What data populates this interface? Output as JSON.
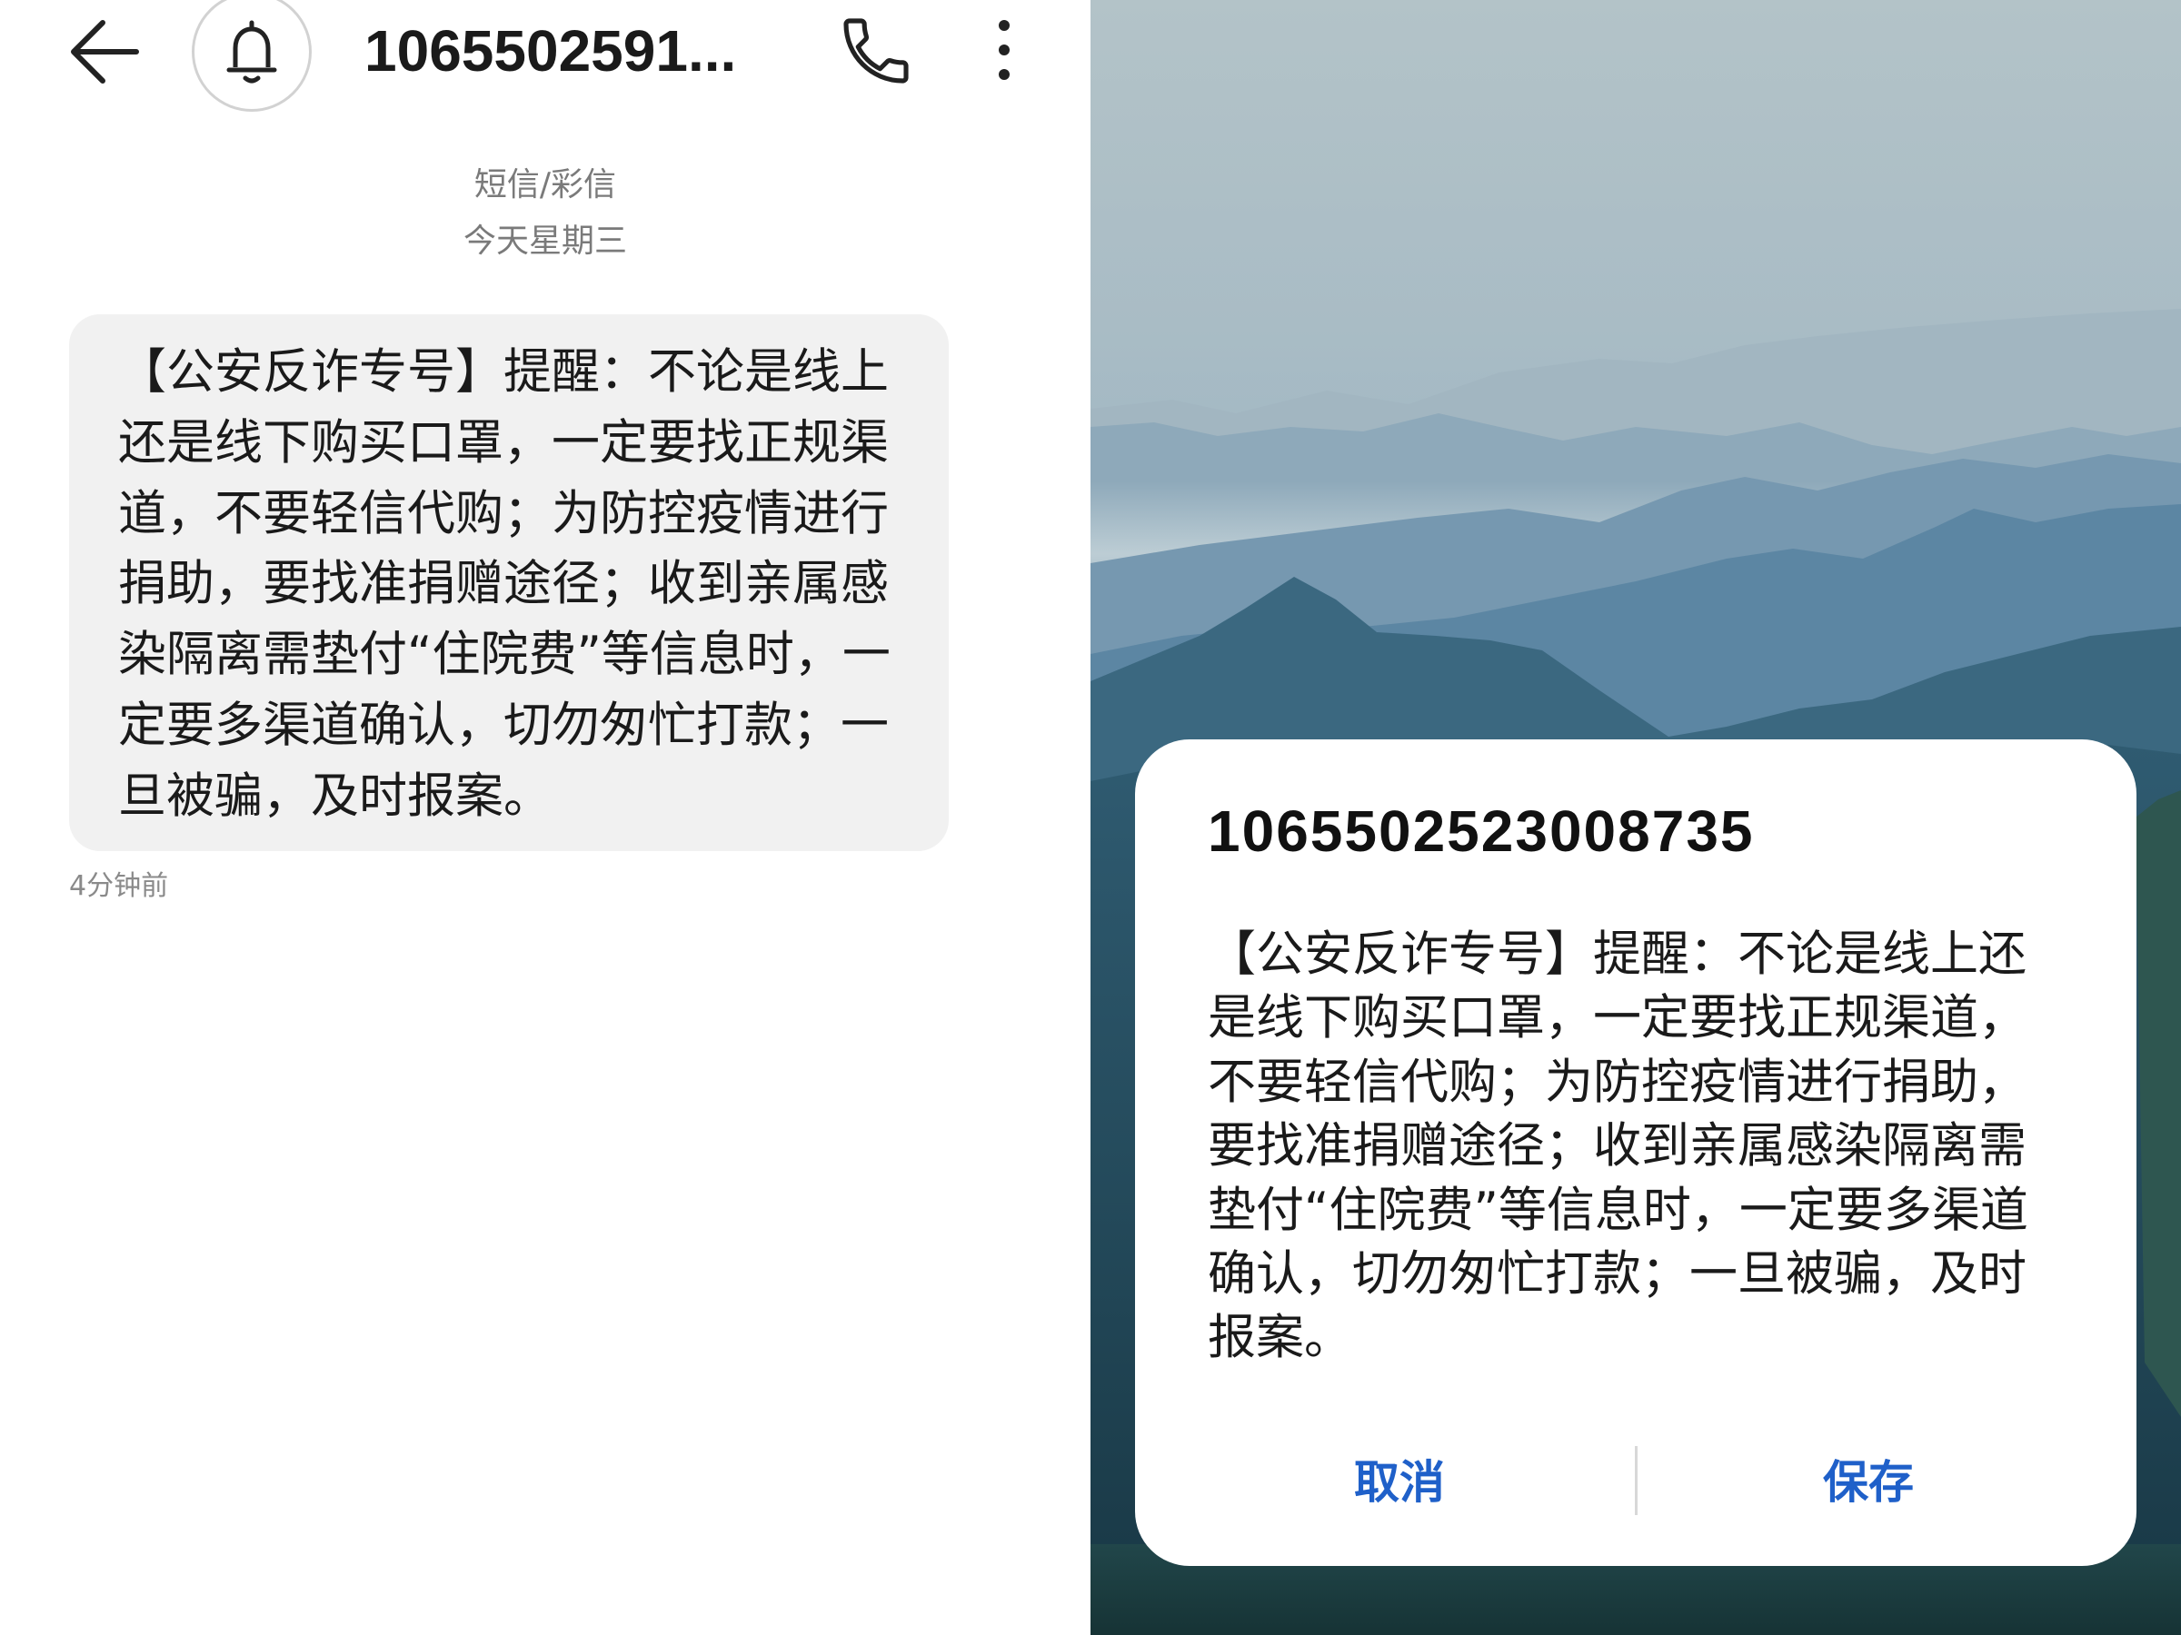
{
  "left": {
    "header": {
      "back_icon": "back-arrow-icon",
      "avatar_icon": "bell-icon",
      "title": "1065502591...",
      "call_icon": "phone-icon",
      "more_icon": "more-vertical-icon"
    },
    "conversation": {
      "channel_label": "短信/彩信",
      "date_label": "今天星期三"
    },
    "message": {
      "lines": [
        "【公安反诈专号】提醒：不论是线上",
        "还是线下购买口罩，一定要找正规渠",
        "道，不要轻信代购；为防控疫情进行",
        "捐助，要找准捐赠途径；收到亲属感",
        "染隔离需垫付“住院费”等信息时，一",
        "定要多渠道确认，切勿匆忙打款；一",
        "旦被骗，及时报案。"
      ],
      "time": "4分钟前"
    }
  },
  "right": {
    "dialog": {
      "sender": "1065502523008735",
      "lines": [
        "【公安反诈专号】提醒：不论是线上还",
        "是线下购买口罩，一定要找正规渠道，",
        "不要轻信代购；为防控疫情进行捐助，",
        "要找准捐赠途径；收到亲属感染隔离需",
        "垫付“住院费”等信息时，一定要多渠道",
        "确认，切勿匆忙打款；一旦被骗，及时",
        "报案。"
      ],
      "cancel_label": "取消",
      "save_label": "保存"
    }
  },
  "colors": {
    "accent": "#1f60c9",
    "bubble": "#f1f1f1",
    "text": "#1a1a1a",
    "secondary_text": "#7a7a7a"
  }
}
